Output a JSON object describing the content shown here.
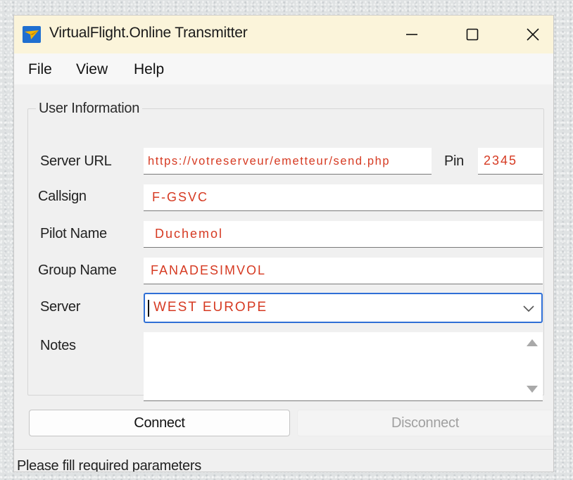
{
  "window": {
    "title": "VirtualFlight.Online Transmitter"
  },
  "menu": {
    "file": "File",
    "view": "View",
    "help": "Help"
  },
  "group": {
    "title": "User Information"
  },
  "fields": {
    "server_url": {
      "label": "Server URL",
      "value": "https://votreserveur/emetteur/send.php"
    },
    "pin": {
      "label": "Pin",
      "value": "2345"
    },
    "callsign": {
      "label": "Callsign",
      "value": "F-GSVC"
    },
    "pilot_name": {
      "label": "Pilot Name",
      "value": "Duchemol"
    },
    "group_name": {
      "label": "Group Name",
      "value": "FANADESIMVOL"
    },
    "server": {
      "label": "Server",
      "value": "WEST EUROPE"
    },
    "notes": {
      "label": "Notes",
      "value": ""
    }
  },
  "buttons": {
    "connect": "Connect",
    "disconnect": "Disconnect"
  },
  "status": {
    "text": "Please fill required parameters"
  },
  "colors": {
    "titlebar": "#fbf4da",
    "field_text": "#d63a22",
    "focus_border": "#2f6fd6"
  },
  "icons": {
    "app": "paper-plane-icon",
    "minimize": "minimize-icon",
    "maximize": "maximize-icon",
    "close": "close-icon",
    "dropdown": "chevron-down-icon"
  }
}
